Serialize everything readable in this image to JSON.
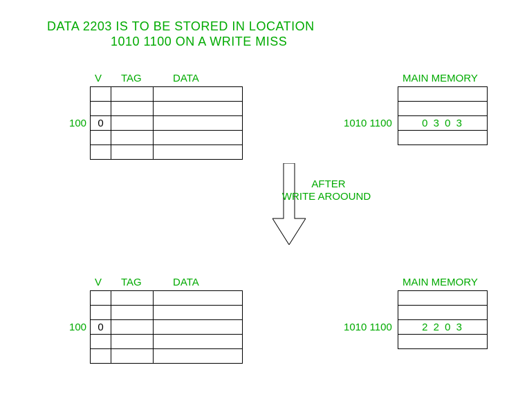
{
  "title_line1": "DATA 2203 IS TO BE STORED IN LOCATION",
  "title_line2": "1010 1100 ON A WRITE MISS",
  "cache1": {
    "v_label": "V",
    "tag_label": "TAG",
    "data_label": "DATA",
    "row_index": "100",
    "v_value": "0"
  },
  "memory1": {
    "heading": "MAIN MEMORY",
    "addr_label": "1010 1100",
    "value": "0 3 0 3"
  },
  "arrow_label_line1": "AFTER",
  "arrow_label_line2": "WRITE AROOUND",
  "cache2": {
    "v_label": "V",
    "tag_label": "TAG",
    "data_label": "DATA",
    "row_index": "100",
    "v_value": "0"
  },
  "memory2": {
    "heading": "MAIN MEMORY",
    "addr_label": "1010 1100",
    "value": "2 2 0 3"
  },
  "chart_data": {
    "type": "table",
    "description": "Write-around cache policy on write miss",
    "write_location": "1010 1100",
    "write_data": "2203",
    "before": {
      "cache_line_100": {
        "V": 0,
        "TAG": null,
        "DATA": null
      },
      "main_memory_1010_1100": "0303"
    },
    "after": {
      "cache_line_100": {
        "V": 0,
        "TAG": null,
        "DATA": null
      },
      "main_memory_1010_1100": "2203"
    }
  }
}
